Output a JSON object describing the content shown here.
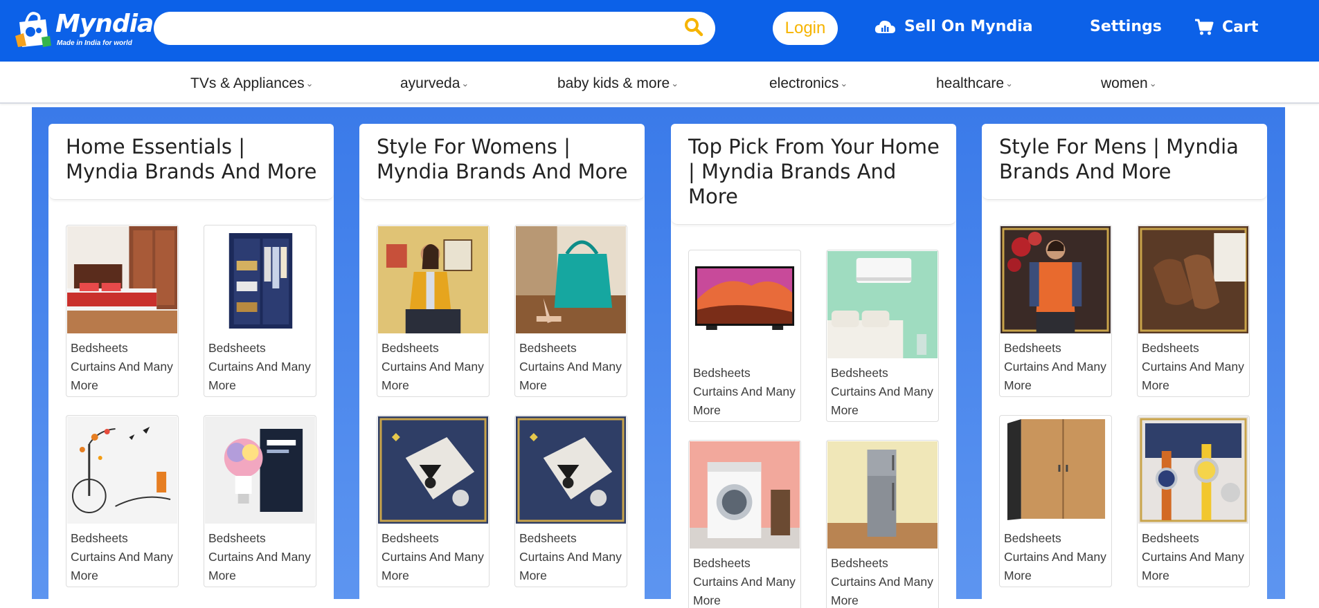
{
  "header": {
    "logo_text": "Myndia",
    "logo_tagline": "Made in India for world",
    "search": {
      "value": "",
      "placeholder": ""
    },
    "login_label": "Login",
    "sell_label": "Sell On Myndia",
    "settings_label": "Settings",
    "cart_label": "Cart",
    "icons": [
      "search-icon",
      "cloud-icon",
      "cart-icon"
    ],
    "colors": {
      "brand": "#0c61e8",
      "login_text": "#f6b400",
      "search_icon": "#f6b400"
    }
  },
  "categories": [
    {
      "label": "TVs & Appliances"
    },
    {
      "label": "ayurveda"
    },
    {
      "label": "baby kids & more"
    },
    {
      "label": "electronics"
    },
    {
      "label": "healthcare"
    },
    {
      "label": "women"
    }
  ],
  "cards": [
    {
      "title": "Home Essentials | Myndia Brands And More",
      "items": [
        {
          "label": "Bedsheets Curtains And Many More",
          "image": "bed"
        },
        {
          "label": "Bedsheets Curtains And Many More",
          "image": "wardrobe"
        },
        {
          "label": "Bedsheets Curtains And Many More",
          "image": "wall-decal"
        },
        {
          "label": "Bedsheets Curtains And Many More",
          "image": "smart-bulb"
        }
      ]
    },
    {
      "title": "Style For Womens | Myndia Brands And More",
      "items": [
        {
          "label": "Bedsheets Curtains And Many More",
          "image": "woman-yellow-jacket"
        },
        {
          "label": "Bedsheets Curtains And Many More",
          "image": "teal-handbag"
        },
        {
          "label": "Bedsheets Curtains And Many More",
          "image": "jewellery"
        },
        {
          "label": "Bedsheets Curtains And Many More",
          "image": "jewellery"
        }
      ]
    },
    {
      "title": "Top Pick From Your Home | Myndia Brands And More",
      "items": [
        {
          "label": "Bedsheets Curtains And Many More",
          "image": "television"
        },
        {
          "label": "Bedsheets Curtains And Many More",
          "image": "air-conditioner"
        },
        {
          "label": "Bedsheets Curtains And Many More",
          "image": "washing-machine"
        },
        {
          "label": "Bedsheets Curtains And Many More",
          "image": "refrigerator"
        }
      ]
    },
    {
      "title": "Style For Mens | Myndia Brands And More",
      "items": [
        {
          "label": "Bedsheets Curtains And Many More",
          "image": "man-orange-vest"
        },
        {
          "label": "Bedsheets Curtains And Many More",
          "image": "leather-shoes"
        },
        {
          "label": "Bedsheets Curtains And Many More",
          "image": "cupboard"
        },
        {
          "label": "Bedsheets Curtains And Many More",
          "image": "wrist-watches"
        }
      ]
    }
  ]
}
